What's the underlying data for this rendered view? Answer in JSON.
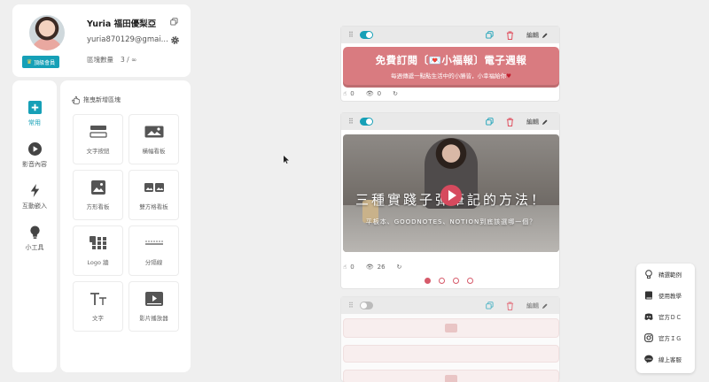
{
  "profile": {
    "name": "Yuria 福田優梨亞",
    "email": "yuria870129@gmai...",
    "badge": "頂級會員",
    "quota_label": "區塊數量",
    "quota_value": "3 / ∞"
  },
  "categories": [
    {
      "label": "常用",
      "icon": "plus-square-icon",
      "active": true
    },
    {
      "label": "影音內容",
      "icon": "play-circle-icon",
      "active": false
    },
    {
      "label": "互動嵌入",
      "icon": "lightning-icon",
      "active": false
    },
    {
      "label": "小工具",
      "icon": "lightbulb-icon",
      "active": false
    }
  ],
  "library": {
    "header": "拖曳新增區塊",
    "tiles": [
      {
        "label": "文字按鈕",
        "icon": "text-button-icon"
      },
      {
        "label": "橫幅看板",
        "icon": "banner-board-icon"
      },
      {
        "label": "方形看板",
        "icon": "square-board-icon"
      },
      {
        "label": "雙方格看板",
        "icon": "double-board-icon"
      },
      {
        "label": "Logo 牆",
        "icon": "logo-wall-icon"
      },
      {
        "label": "分隔線",
        "icon": "divider-icon"
      },
      {
        "label": "文字",
        "icon": "text-icon"
      },
      {
        "label": "影片播放器",
        "icon": "video-player-icon"
      }
    ]
  },
  "blocks": {
    "edit_label": "編輯",
    "banner": {
      "title": "免費訂閱〔💌小福報〕電子週報",
      "subtitle": "每週傳遞一點點生活中的小勝皆，小幸福給你",
      "likes": "0",
      "views": "0",
      "enabled": true
    },
    "video": {
      "title": "三種實踐子彈筆記的方法！",
      "subtitle": "平板本、GOODNOTES、NOTION到底該選哪一個？",
      "likes": "0",
      "views": "26",
      "enabled": true,
      "slides": 4,
      "active_slide": 1
    },
    "third": {
      "enabled": false
    }
  },
  "help_menu": [
    {
      "label": "精選範例",
      "icon": "lightbulb-icon"
    },
    {
      "label": "使用教學",
      "icon": "book-icon"
    },
    {
      "label": "官方ＤＣ",
      "icon": "discord-icon"
    },
    {
      "label": "官方ＩＧ",
      "icon": "instagram-icon"
    },
    {
      "label": "線上客服",
      "icon": "line-icon"
    }
  ],
  "colors": {
    "accent": "#16a0b7",
    "banner": "#d97b80",
    "danger": "#e0505f",
    "background": "#efefef"
  }
}
